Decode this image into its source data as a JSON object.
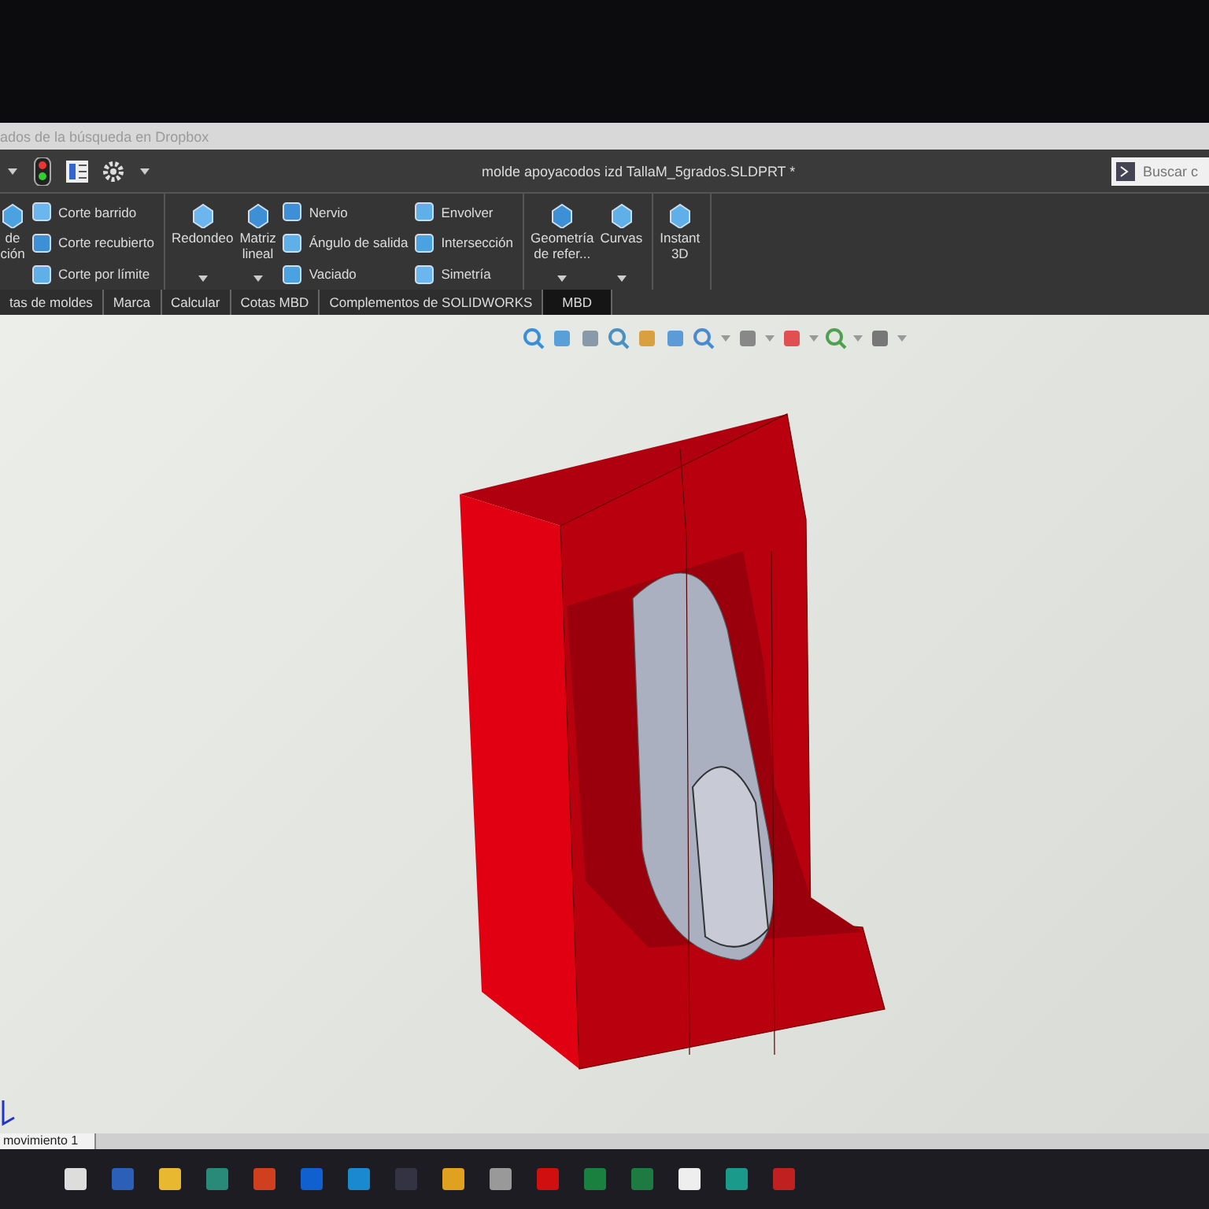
{
  "dropbox_bar": {
    "text": "ados de la búsqueda en Dropbox"
  },
  "title_bar": {
    "title": "molde apoyacodos izd TallaM_5grados.SLDPRT *",
    "search": {
      "placeholder": "Buscar c"
    }
  },
  "ribbon": {
    "groups": [
      {
        "columns": [
          {
            "kind": "large",
            "label": "de\nción",
            "dropdown": false
          },
          {
            "kind": "stack",
            "items": [
              "Corte barrido",
              "Corte recubierto",
              "Corte por límite"
            ]
          }
        ]
      },
      {
        "columns": [
          {
            "kind": "large",
            "label": "Redondeo",
            "dropdown": true
          },
          {
            "kind": "large",
            "label": "Matriz\nlineal",
            "dropdown": true
          },
          {
            "kind": "stack",
            "items": [
              "Nervio",
              "Ángulo de salida",
              "Vaciado"
            ]
          },
          {
            "kind": "stack",
            "items": [
              "Envolver",
              "Intersección",
              "Simetría"
            ]
          }
        ]
      },
      {
        "columns": [
          {
            "kind": "large",
            "label": "Geometría\nde refer...",
            "dropdown": true
          },
          {
            "kind": "large",
            "label": "Curvas",
            "dropdown": true
          }
        ]
      },
      {
        "columns": [
          {
            "kind": "large",
            "label": "Instant\n3D",
            "dropdown": false
          }
        ]
      }
    ]
  },
  "tabs": [
    {
      "label": "tas de moldes",
      "selected": false
    },
    {
      "label": "Marca",
      "selected": false
    },
    {
      "label": "Calcular",
      "selected": false
    },
    {
      "label": "Cotas MBD",
      "selected": false
    },
    {
      "label": "Complementos de SOLIDWORKS",
      "selected": false
    },
    {
      "label": "MBD",
      "selected": true
    }
  ],
  "bottom_tab": {
    "label": "movimiento 1"
  }
}
